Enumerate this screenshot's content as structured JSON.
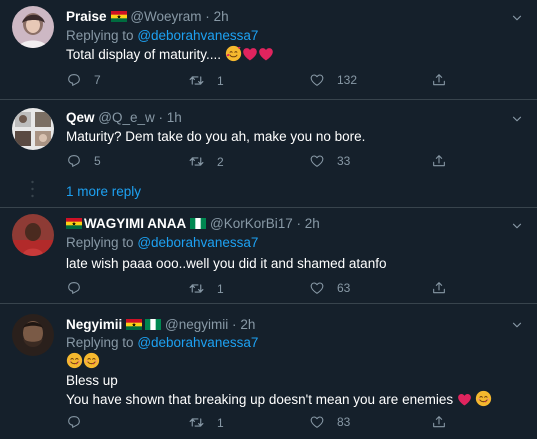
{
  "tweets": [
    {
      "name": "Praise",
      "handle": "@Woeyram",
      "time": "2h",
      "replying_prefix": "Replying to",
      "replying_to": "@deborahvanessa7",
      "text": "Total display of maturity....",
      "text_emojis": [
        "smiling-face-with-hearts",
        "red-heart",
        "red-heart"
      ],
      "replies": "7",
      "retweets": "1",
      "likes": "132",
      "name_flags": [
        "ghana"
      ]
    },
    {
      "name": "Qew",
      "handle": "@Q_e_w",
      "time": "1h",
      "text": "Maturity? Dem take do you ah, make you no bore.",
      "replies": "5",
      "retweets": "2",
      "likes": "33"
    },
    {
      "name": "WAGYIMI ANAA",
      "handle": "@KorKorBi17",
      "time": "2h",
      "replying_prefix": "Replying to",
      "replying_to": "@deborahvanessa7",
      "text": "late wish paaa ooo..well you did it and shamed atanfo",
      "replies": "",
      "retweets": "1",
      "likes": "63",
      "name_flags": [
        "ghana",
        "nigeria"
      ]
    },
    {
      "name": "Negyimii",
      "handle": "@negyimii",
      "time": "2h",
      "replying_prefix": "Replying to",
      "replying_to": "@deborahvanessa7",
      "text_line2": "Bless up",
      "text_line3": "You have shown that breaking up doesn't mean you are enemies",
      "replies": "",
      "retweets": "1",
      "likes": "83",
      "name_flags": [
        "ghana",
        "nigeria"
      ]
    }
  ],
  "thread": {
    "more_replies": "1 more reply"
  },
  "dot": "·",
  "colors": {
    "background": "#15202b",
    "link": "#1da1f2",
    "muted": "#8899a6",
    "divider": "#38444d",
    "heart": "#e0245e"
  },
  "icons": [
    "reply-icon",
    "retweet-icon",
    "like-icon",
    "share-icon",
    "chevron-down-icon"
  ]
}
